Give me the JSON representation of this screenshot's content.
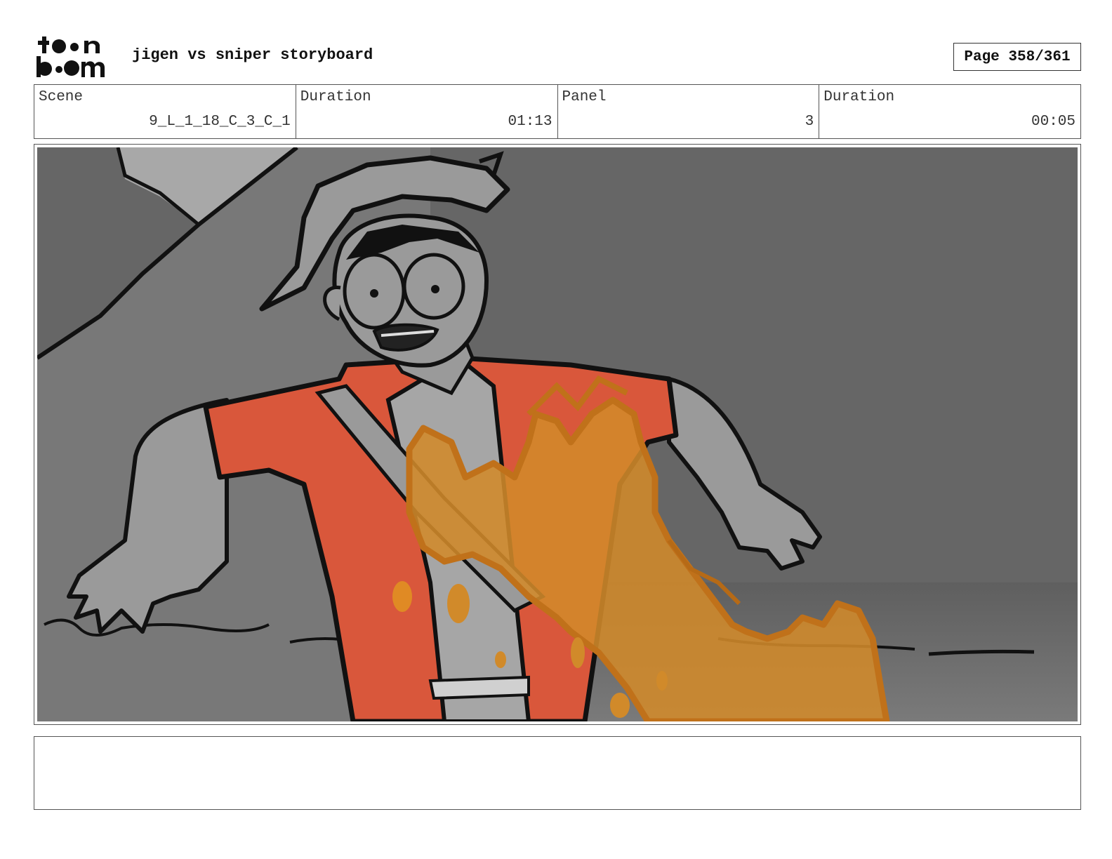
{
  "header": {
    "logo_text": "toon boom",
    "title": "jigen vs sniper storyboard",
    "page_label": "Page 358/361"
  },
  "info": {
    "scene_label": "Scene",
    "scene_value": "9_L_1_18_C_3_C_1",
    "duration_label": "Duration",
    "duration_value": "01:13",
    "panel_label": "Panel",
    "panel_value": "3",
    "panel_duration_label": "Duration",
    "panel_duration_value": "00:05"
  },
  "panel": {
    "icon": "storyboard-drawing",
    "colors": {
      "background": "#666666",
      "rock": "#7a7a7a",
      "sky": "#a8a8a8",
      "skin": "#9a9a9a",
      "jacket": "#d9573b",
      "shirt": "#a6a6a6",
      "blast_fill": "#d18a2a",
      "blast_line": "#c0711a",
      "ink": "#111111"
    }
  },
  "notes": {
    "text": ""
  }
}
